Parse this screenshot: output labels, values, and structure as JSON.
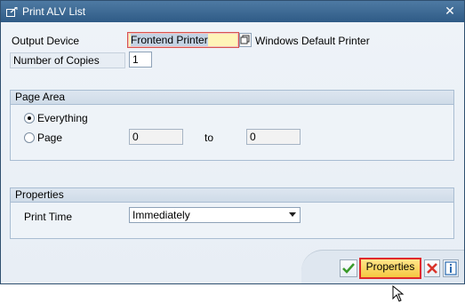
{
  "window": {
    "title": "Print ALV List"
  },
  "fields": {
    "output_device_label": "Output Device",
    "output_device_value": "Frontend Printer",
    "output_device_desc": "Windows Default Printer",
    "copies_label": "Number of Copies",
    "copies_value": "1"
  },
  "page_area": {
    "header": "Page Area",
    "everything_label": "Everything",
    "page_label": "Page",
    "from_value": "0",
    "to_label": "to",
    "to_value": "0",
    "selected": "Everything"
  },
  "properties": {
    "header": "Properties",
    "print_time_label": "Print Time",
    "print_time_value": "Immediately"
  },
  "buttons": {
    "properties_label": "Properties"
  },
  "colors": {
    "title_bar": "#2f5b86",
    "focus_highlight": "#fff4b8",
    "properties_button": "#f5c842",
    "highlight_border": "#e0282c",
    "ok_green": "#3a9a2a",
    "cancel_red": "#d9342b",
    "info_blue": "#2a6ab0"
  },
  "icons": [
    "print-dialog-icon",
    "close-icon",
    "value-help-icon",
    "ok-check-icon",
    "cancel-icon",
    "info-icon",
    "mouse-cursor-icon"
  ]
}
